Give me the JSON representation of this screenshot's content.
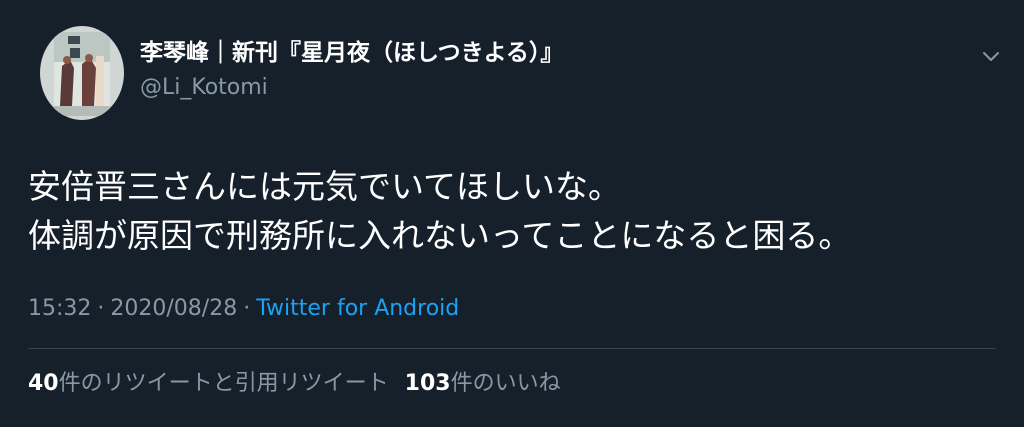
{
  "author": {
    "display_name": "李琴峰｜新刊『星月夜（ほしつきよる）』",
    "handle": "@Li_Kotomi",
    "avatar_icon": "book-cover-avatar"
  },
  "tweet": {
    "lines": [
      "安倍晋三さんには元気でいてほしいな。",
      "体調が原因で刑務所に入れないってことになると困る。"
    ]
  },
  "meta": {
    "time": "15:32",
    "separator": "·",
    "date": "2020/08/28",
    "source": "Twitter for Android"
  },
  "stats": {
    "retweets_count": "40",
    "retweets_label": "件のリツイートと引用リツイート",
    "likes_count": "103",
    "likes_label": "件のいいね"
  },
  "colors": {
    "background": "#15202b",
    "secondary_text": "#8899a6",
    "link": "#1da1f2",
    "divider": "#38444d"
  }
}
